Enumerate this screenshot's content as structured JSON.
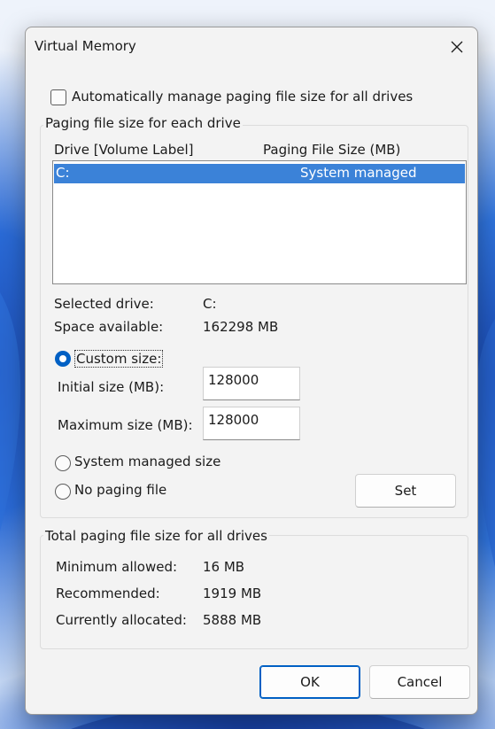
{
  "dialog": {
    "title": "Virtual Memory",
    "auto_manage_label": "Automatically manage paging file size for all drives",
    "auto_manage_checked": false,
    "paging_group_label": "Paging file size for each drive",
    "columns": {
      "drive": "Drive  [Volume Label]",
      "size": "Paging File Size (MB)"
    },
    "drives": [
      {
        "drive": "C:",
        "size": "System managed"
      }
    ],
    "selected_drive_label": "Selected drive:",
    "selected_drive_value": "C:",
    "space_available_label": "Space available:",
    "space_available_value": "162298 MB",
    "custom_size_label": "Custom size:",
    "initial_size_label": "Initial size (MB):",
    "initial_size_value": "128000",
    "maximum_size_label": "Maximum size (MB):",
    "maximum_size_value": "128000",
    "system_managed_label": "System managed size",
    "no_paging_label": "No paging file",
    "selected_option": "custom",
    "set_button": "Set",
    "total_group_label": "Total paging file size for all drives",
    "minimum_allowed_label": "Minimum allowed:",
    "minimum_allowed_value": "16 MB",
    "recommended_label": "Recommended:",
    "recommended_value": "1919 MB",
    "currently_allocated_label": "Currently allocated:",
    "currently_allocated_value": "5888 MB",
    "ok_button": "OK",
    "cancel_button": "Cancel"
  },
  "colors": {
    "accent": "#0060c4",
    "selection": "#3b82d8",
    "dialog_bg": "#f3f3f3"
  },
  "icons": {
    "close": "close-icon",
    "radio_selected": "radio-selected",
    "checkbox": "checkbox-unchecked"
  }
}
